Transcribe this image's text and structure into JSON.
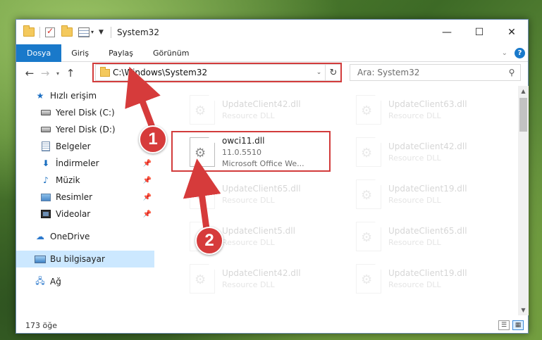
{
  "window": {
    "title": "System32",
    "controls": [
      "—",
      "☐",
      "✕"
    ]
  },
  "ribbon": {
    "tabs": [
      "Dosya",
      "Giriş",
      "Paylaş",
      "Görünüm"
    ],
    "help": "?"
  },
  "navigation": {
    "address": "C:\\Windows\\System32",
    "search_placeholder": "Ara: System32"
  },
  "sidebar": {
    "quick_access": "Hızlı erişim",
    "items": [
      {
        "label": "Yerel Disk (C:)",
        "icon": "drive-icon",
        "pinned": false
      },
      {
        "label": "Yerel Disk (D:)",
        "icon": "drive-icon",
        "pinned": false
      },
      {
        "label": "Belgeler",
        "icon": "documents-icon",
        "pinned": true
      },
      {
        "label": "İndirmeler",
        "icon": "downloads-icon",
        "pinned": true
      },
      {
        "label": "Müzik",
        "icon": "music-icon",
        "pinned": true
      },
      {
        "label": "Resimler",
        "icon": "pictures-icon",
        "pinned": true
      },
      {
        "label": "Videolar",
        "icon": "videos-icon",
        "pinned": true
      }
    ],
    "onedrive": "OneDrive",
    "this_pc": "Bu bilgisayar",
    "network": "Ağ"
  },
  "files": {
    "left_column": [
      {
        "name": "UpdateClient42.dll",
        "type": "Resource DLL"
      },
      {
        "name": "owci11.dll",
        "version": "11.0.5510",
        "description": "Microsoft Office We..."
      },
      {
        "name": "UpdateClient65.dll",
        "type": "Resource DLL"
      },
      {
        "name": "UpdateClient5.dll",
        "type": "Resource DLL"
      },
      {
        "name": "UpdateClient42.dll",
        "type": "Resource DLL"
      }
    ],
    "right_column": [
      {
        "name": "UpdateClient63.dll",
        "type": "Resource DLL"
      },
      {
        "name": "UpdateClient42.dll",
        "type": "Resource DLL"
      },
      {
        "name": "UpdateClient19.dll",
        "type": "Resource DLL"
      },
      {
        "name": "UpdateClient65.dll",
        "type": "Resource DLL"
      },
      {
        "name": "UpdateClient19.dll",
        "type": "Resource DLL"
      }
    ]
  },
  "status": {
    "item_count": "173 öğe"
  },
  "annotations": {
    "step1": "1",
    "step2": "2",
    "color": "#d63b3b"
  }
}
